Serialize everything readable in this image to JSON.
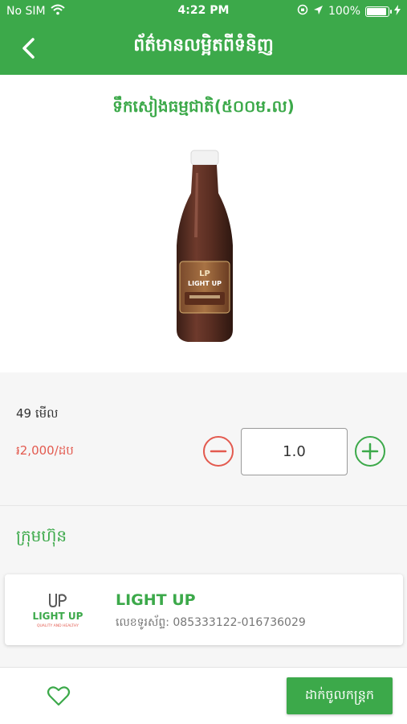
{
  "status_bar": {
    "carrier": "No SIM",
    "time": "4:22 PM",
    "battery": "100%"
  },
  "header": {
    "title": "ព័ត៌មានលម្អិតពីទំនិញ"
  },
  "product": {
    "name": "ទឹកសៀងធម្មជាតិ(៥០០ម.ល)",
    "image_label": "LIGHT UP"
  },
  "info": {
    "views": "49 មើល",
    "price": "៛2,000/ដប",
    "quantity": "1.0"
  },
  "company": {
    "heading": "ក្រុមហ៊ុន",
    "name": "LIGHT UP",
    "phone": "លេខទូរស័ព្ទ: 085333122-016736029",
    "logo_text": "LIGHT UP",
    "logo_tagline": "QUALITY AND HEALTHY"
  },
  "bottom": {
    "add_to_cart": "ដាក់ចូលកន្ត្រក"
  },
  "colors": {
    "brand_green": "#3ca94a",
    "price_red": "#e35a4f",
    "minus_red": "#e35a4f"
  },
  "icons": {
    "back": "chevron-left-icon",
    "minus": "minus-circle-icon",
    "plus": "plus-circle-icon",
    "favorite": "heart-outline-icon",
    "wifi": "wifi-icon",
    "location": "location-arrow-icon",
    "lock_rotation": "orientation-lock-icon",
    "battery": "battery-icon",
    "charging": "charging-bolt-icon"
  }
}
